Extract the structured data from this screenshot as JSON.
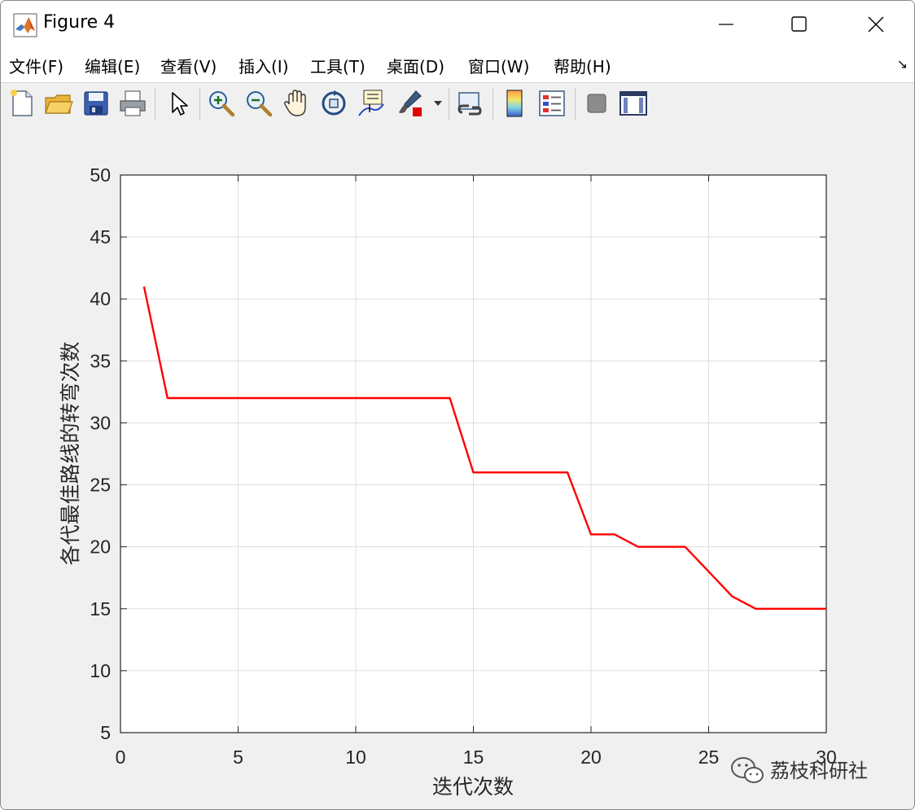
{
  "window": {
    "title": "Figure 4",
    "icon": "matlab-icon",
    "controls": [
      "minimize-icon",
      "maximize-icon",
      "close-icon"
    ]
  },
  "menu": {
    "items": [
      {
        "label": "文件(F)",
        "mnemonic": "F"
      },
      {
        "label": "编辑(E)",
        "mnemonic": "E"
      },
      {
        "label": "查看(V)",
        "mnemonic": "V"
      },
      {
        "label": "插入(I)",
        "mnemonic": "I"
      },
      {
        "label": "工具(T)",
        "mnemonic": "T"
      },
      {
        "label": "桌面(D)",
        "mnemonic": "D"
      },
      {
        "label": "窗口(W)",
        "mnemonic": "W"
      },
      {
        "label": "帮助(H)",
        "mnemonic": "H"
      }
    ],
    "dock_arrow": "↘"
  },
  "toolbar": {
    "buttons": [
      "new-figure-icon",
      "open-file-icon",
      "save-icon",
      "print-icon",
      "edit-plot-icon",
      "zoom-in-icon",
      "zoom-out-icon",
      "pan-icon",
      "rotate-3d-icon",
      "data-cursor-icon",
      "brush-icon",
      "brush-dropdown-icon",
      "link-plot-icon",
      "colorbar-icon",
      "legend-icon",
      "hide-plot-tools-icon",
      "show-plot-tools-icon"
    ]
  },
  "watermark": {
    "text": "荔枝科研社",
    "icon": "wechat-icon"
  },
  "colors": {
    "line": "#ff0000",
    "grid": "#dfdfdf",
    "axes_bg": "#ffffff",
    "figure_bg": "#f0f0f0"
  },
  "chart_data": {
    "type": "line",
    "title": "",
    "xlabel": "迭代次数",
    "ylabel": "各代最佳路线的转弯次数",
    "xlim": [
      0,
      30
    ],
    "ylim": [
      5,
      50
    ],
    "xticks": [
      0,
      5,
      10,
      15,
      20,
      25,
      30
    ],
    "yticks": [
      5,
      10,
      15,
      20,
      25,
      30,
      35,
      40,
      45,
      50
    ],
    "grid": true,
    "legend": "none",
    "series": [
      {
        "color": "#ff0000",
        "x": [
          1,
          2,
          3,
          4,
          5,
          6,
          7,
          8,
          9,
          10,
          11,
          12,
          13,
          14,
          15,
          16,
          17,
          18,
          19,
          20,
          21,
          22,
          23,
          24,
          25,
          26,
          27,
          28,
          29,
          30
        ],
        "y": [
          41,
          32,
          32,
          32,
          32,
          32,
          32,
          32,
          32,
          32,
          32,
          32,
          32,
          32,
          26,
          26,
          26,
          26,
          26,
          21,
          21,
          20,
          20,
          20,
          18,
          16,
          15,
          15,
          15,
          15
        ]
      }
    ]
  }
}
